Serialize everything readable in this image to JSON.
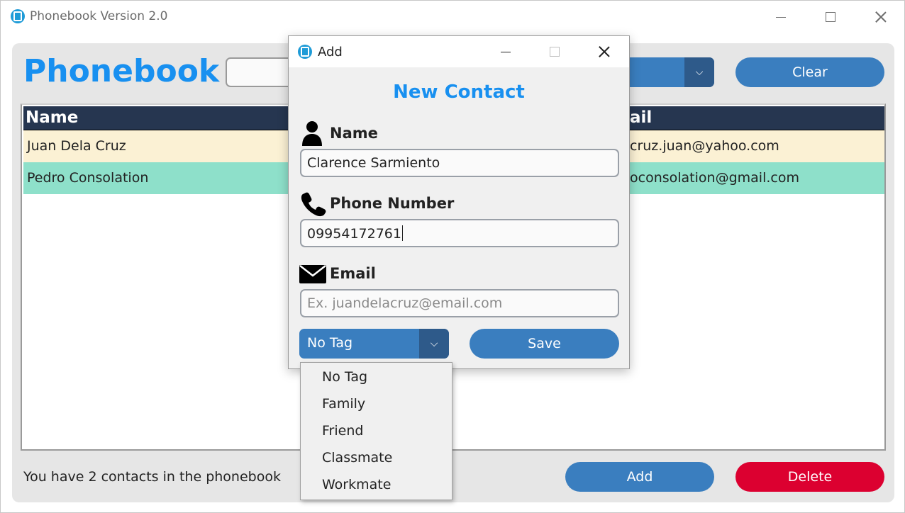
{
  "window": {
    "title": "Phonebook Version 2.0",
    "icon": "phonebook-app-icon",
    "controls": [
      "minimize",
      "maximize",
      "close"
    ]
  },
  "header": {
    "heading": "Phonebook",
    "search_value": "",
    "clear_label": "Clear"
  },
  "table": {
    "columns": [
      "Name",
      "ail"
    ],
    "rows": [
      {
        "name": "Juan Dela Cruz",
        "email": "cruz.juan@yahoo.com"
      },
      {
        "name": "Pedro Consolation",
        "email": "oconsolation@gmail.com"
      }
    ]
  },
  "footer": {
    "status": "You have 2 contacts in the phonebook",
    "add_label": "Add",
    "delete_label": "Delete"
  },
  "dialog": {
    "title": "Add",
    "heading": "New Contact",
    "name_label": "Name",
    "name_value": "Clarence Sarmiento",
    "phone_label": "Phone Number",
    "phone_value": "09954172761",
    "email_label": "Email",
    "email_placeholder": "Ex. juandelacruz@email.com",
    "tag_selected": "No Tag",
    "save_label": "Save"
  },
  "tag_dropdown": {
    "options": [
      "No Tag",
      "Family",
      "Friend",
      "Classmate",
      "Workmate"
    ]
  },
  "colors": {
    "accent_blue": "#1890f0",
    "button_blue": "#3a7ebf",
    "button_red": "#dc0030",
    "table_header": "#263650",
    "row_yellow": "#fbf1d4",
    "row_green": "#8ee0ca"
  }
}
